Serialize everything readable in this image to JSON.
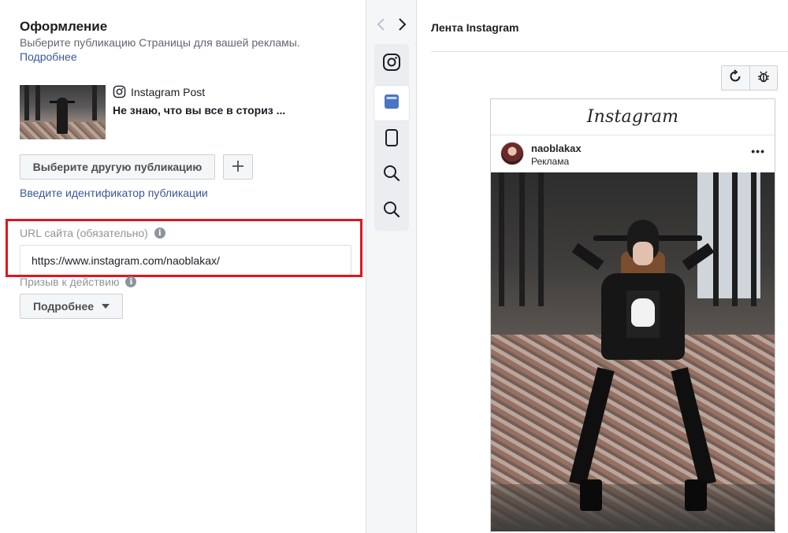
{
  "design": {
    "title": "Оформление",
    "subtitle": "Выберите публикацию Страницы для вашей рекламы.",
    "learn_more": "Подробнее",
    "post": {
      "type_label": "Instagram Post",
      "caption": "Не знаю, что вы все в сториз ..."
    },
    "choose_other_label": "Выберите другую публикацию",
    "add_label": "+",
    "enter_id_link": "Введите идентификатор публикации",
    "url_label": "URL сайта (обязательно)",
    "url_value": "https://www.instagram.com/naoblakax/",
    "cta_label": "Призыв к действию",
    "cta_value": "Подробнее",
    "info_glyph": "i"
  },
  "toolbar": {
    "back_icon": "chevron-left-icon",
    "forward_icon": "chevron-right-icon",
    "placements": [
      "instagram-icon",
      "feed-icon",
      "stories-icon",
      "explore-icon",
      "search-icon"
    ],
    "active": "feed-icon"
  },
  "preview": {
    "title": "Лента Instagram",
    "refresh_icon": "refresh-icon",
    "bug_icon": "bug-icon",
    "ig_logo": "Instagram",
    "username": "naoblakax",
    "sponsored": "Реклама",
    "menu_glyph": "•••"
  },
  "colors": {
    "link": "#385898",
    "highlight": "#e0151c",
    "active_placement": "#4a76c2"
  }
}
